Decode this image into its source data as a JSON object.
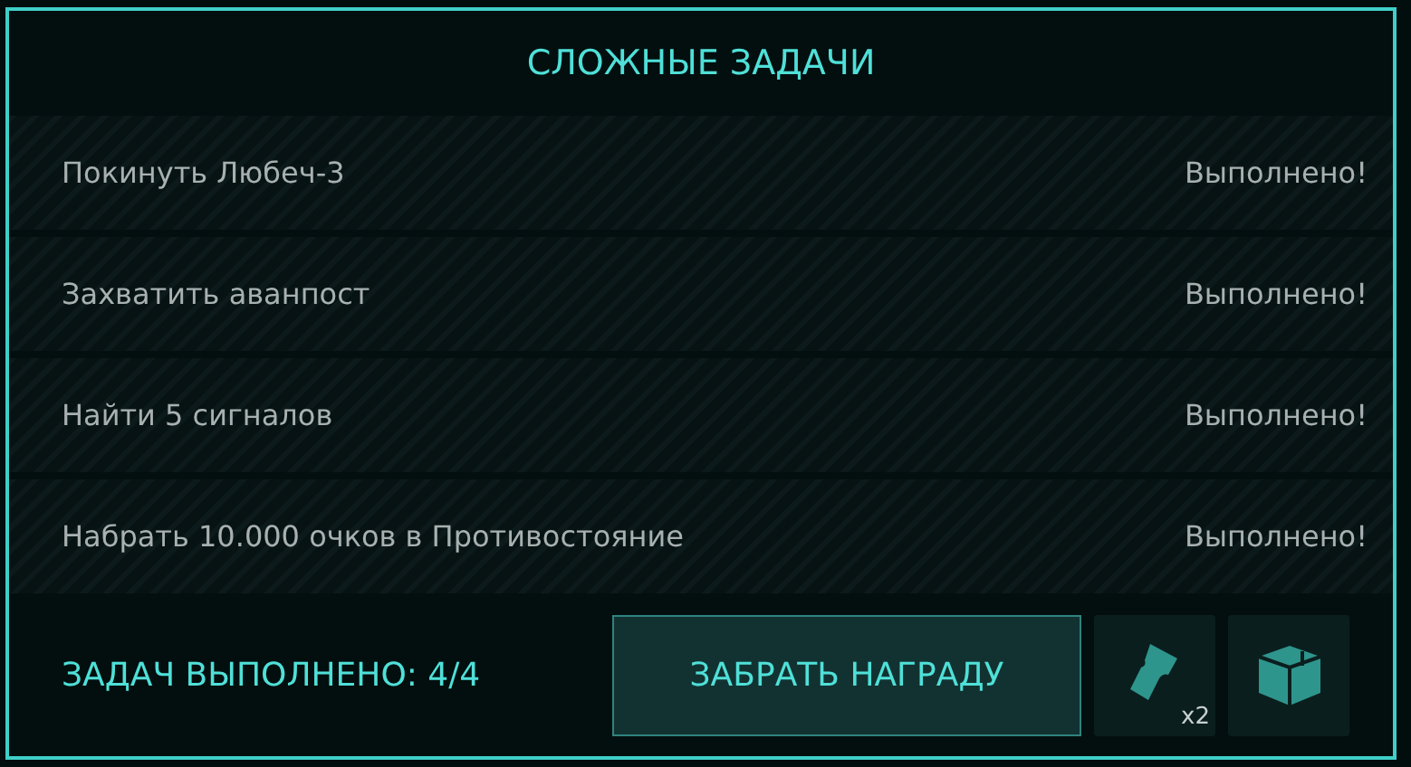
{
  "title": "СЛОЖНЫЕ ЗАДАЧИ",
  "tasks": [
    {
      "name": "Покинуть Любеч-3",
      "status": "Выполнено!"
    },
    {
      "name": "Захватить аванпост",
      "status": "Выполнено!"
    },
    {
      "name": "Найти 5 сигналов",
      "status": "Выполнено!"
    },
    {
      "name": "Набрать 10.000 очков в Противостояние",
      "status": "Выполнено!"
    }
  ],
  "footer": {
    "progress": "ЗАДАЧ ВЫПОЛНЕНО: 4/4",
    "button": "ЗАБРАТЬ НАГРАДУ",
    "rewards": [
      {
        "kind": "ticket",
        "count": "x2"
      },
      {
        "kind": "box"
      }
    ]
  }
}
